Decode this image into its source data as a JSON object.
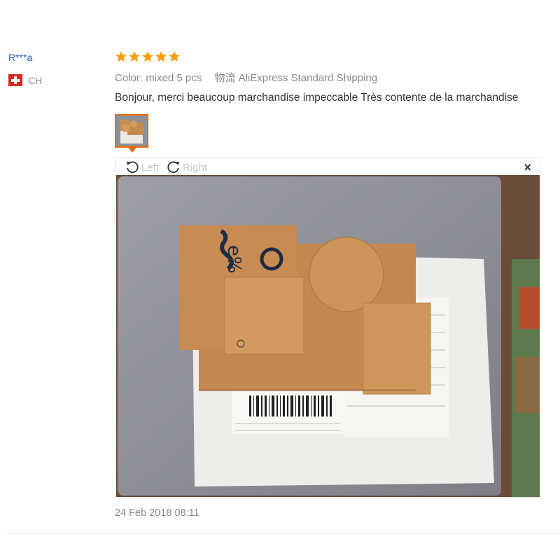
{
  "review": {
    "user": "R***a",
    "country_code": "CH",
    "rating": 5,
    "color_label": "Color:",
    "color_value": "mixed 5 pcs",
    "shipping_label": "物流",
    "shipping_value": "AliExpress Standard Shipping",
    "text": "Bonjour, merci beaucoup marchandise impeccable Très contente de la marchandise",
    "date": "24 Feb 2018 08:11"
  },
  "viewer": {
    "rotate_left_label": "Left",
    "rotate_right_label": "Right",
    "close_label": "×"
  },
  "colors": {
    "accent": "#e96a11",
    "star": "#ff9b0d",
    "username": "#2f5fa8",
    "muted": "#888888"
  }
}
